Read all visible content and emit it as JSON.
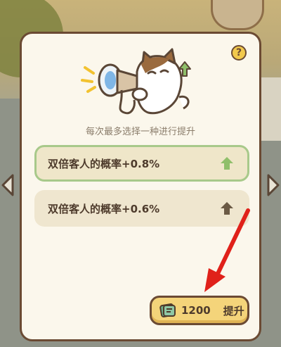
{
  "panel": {
    "help_symbol": "?",
    "subtitle": "每次最多选择一种进行提升",
    "hero_icon": "cat-megaphone-icon"
  },
  "options": [
    {
      "label": "双倍客人的概率+0.8%",
      "state": "selected",
      "arrow_color": "#8fbf6a"
    },
    {
      "label": "双倍客人的概率+0.6%",
      "state": "default",
      "arrow_color": "#6b5a45"
    }
  ],
  "upgrade_button": {
    "cost": "1200",
    "label": "提升",
    "currency_icon": "ticket-icon"
  },
  "colors": {
    "panel_bg": "#fbf7ec",
    "panel_border": "#6b4a33",
    "selected_border": "#a8c98a",
    "button_bg": "#f4d47a",
    "pointer": "#e0211a"
  }
}
